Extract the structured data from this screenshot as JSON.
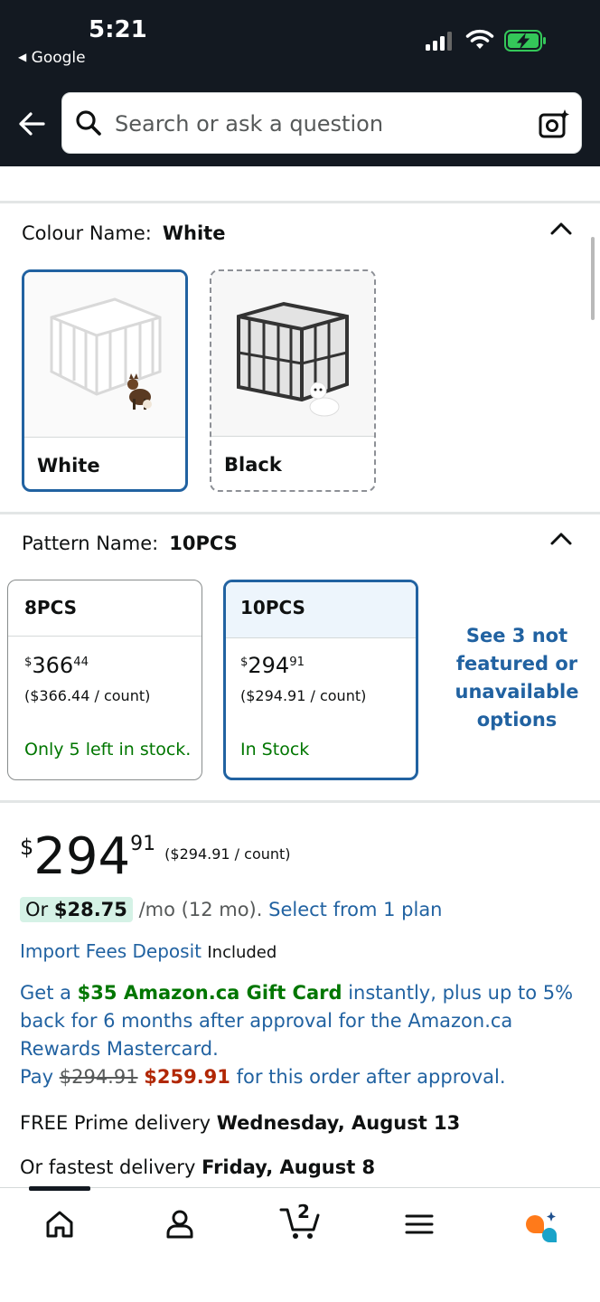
{
  "status_bar": {
    "time": "5:21",
    "back_app": "Google"
  },
  "search": {
    "placeholder": "Search or ask a question"
  },
  "colour": {
    "label": "Colour Name:",
    "selected": "White",
    "options": [
      {
        "label": "White",
        "selected": true
      },
      {
        "label": "Black",
        "selected": false
      }
    ]
  },
  "pattern": {
    "label": "Pattern Name:",
    "selected": "10PCS",
    "options": [
      {
        "name": "8PCS",
        "price_dollars": "366",
        "price_cents": "44",
        "unit_price": "($366.44 / count)",
        "stock": "Only 5 left in stock."
      },
      {
        "name": "10PCS",
        "price_dollars": "294",
        "price_cents": "91",
        "unit_price": "($294.91 / count)",
        "stock": "In Stock"
      }
    ],
    "see_more": "See 3 not featured or unavailable options"
  },
  "price": {
    "symbol": "$",
    "dollars": "294",
    "cents": "91",
    "unit": "($294.91 / count)"
  },
  "monthly": {
    "prefix": "Or",
    "amount": "$28.75",
    "term": "/mo (12 mo).",
    "link": "Select from 1 plan"
  },
  "import_fees": {
    "link": "Import Fees Deposit",
    "value": "Included"
  },
  "promo": {
    "part1": "Get a",
    "gift": "$35 Amazon.ca Gift Card",
    "part2": "instantly, plus up to 5% back for 6 months after approval for the Amazon.ca Rewards Mastercard.",
    "pay": "Pay",
    "old_price": "$294.91",
    "new_price": "$259.91",
    "part3": "for this order after approval."
  },
  "delivery": {
    "line1_prefix": "FREE Prime delivery",
    "line1_date": "Wednesday, August 13",
    "line2_prefix": "Or fastest delivery",
    "line2_date": "Friday, August 8"
  },
  "bottom_nav": {
    "cart_count": "2",
    "icons": [
      "home-icon",
      "account-icon",
      "cart-icon",
      "menu-icon",
      "rufus-icon"
    ]
  },
  "colors": {
    "header_bg": "#131921",
    "link": "#2162a1",
    "selected_border": "#2162a1",
    "stock_green": "#007600",
    "deal_red": "#b12704",
    "battery_green": "#34c759"
  }
}
